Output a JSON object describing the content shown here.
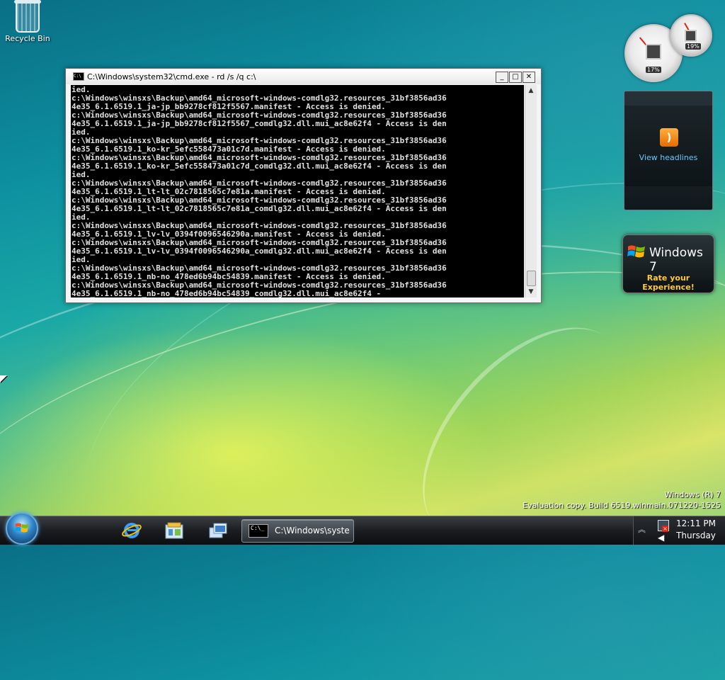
{
  "desktop": {
    "icons": [
      {
        "label": "Recycle Bin",
        "icon": "recycle-bin-icon"
      }
    ],
    "build_info": {
      "line1": "Windows (R) 7",
      "line2": "Evaluation copy. Build 6519.winmain.071220-1525"
    }
  },
  "cmd_window": {
    "title": "C:\\Windows\\system32\\cmd.exe - rd  /s /q c:\\",
    "controls": {
      "minimize": "_",
      "maximize": "□",
      "close": "✕"
    },
    "output": [
      "ied.",
      "c:\\Windows\\winsxs\\Backup\\amd64_microsoft-windows-comdlg32.resources_31bf3856ad36",
      "4e35_6.1.6519.1_ja-jp_bb9278cf812f5567.manifest - Access is denied.",
      "c:\\Windows\\winsxs\\Backup\\amd64_microsoft-windows-comdlg32.resources_31bf3856ad36",
      "4e35_6.1.6519.1_ja-jp_bb9278cf812f5567_comdlg32.dll.mui_ac8e62f4 - Access is den",
      "ied.",
      "c:\\Windows\\winsxs\\Backup\\amd64_microsoft-windows-comdlg32.resources_31bf3856ad36",
      "4e35_6.1.6519.1_ko-kr_5efc558473a01c7d.manifest - Access is denied.",
      "c:\\Windows\\winsxs\\Backup\\amd64_microsoft-windows-comdlg32.resources_31bf3856ad36",
      "4e35_6.1.6519.1_ko-kr_5efc558473a01c7d_comdlg32.dll.mui_ac8e62f4 - Access is den",
      "ied.",
      "c:\\Windows\\winsxs\\Backup\\amd64_microsoft-windows-comdlg32.resources_31bf3856ad36",
      "4e35_6.1.6519.1_lt-lt_02c7818565c7e81a.manifest - Access is denied.",
      "c:\\Windows\\winsxs\\Backup\\amd64_microsoft-windows-comdlg32.resources_31bf3856ad36",
      "4e35_6.1.6519.1_lt-lt_02c7818565c7e81a_comdlg32.dll.mui_ac8e62f4 - Access is den",
      "ied.",
      "c:\\Windows\\winsxs\\Backup\\amd64_microsoft-windows-comdlg32.resources_31bf3856ad36",
      "4e35_6.1.6519.1_lv-lv_0394f0096546290a.manifest - Access is denied.",
      "c:\\Windows\\winsxs\\Backup\\amd64_microsoft-windows-comdlg32.resources_31bf3856ad36",
      "4e35_6.1.6519.1_lv-lv_0394f0096546290a_comdlg32.dll.mui_ac8e62f4 - Access is den",
      "ied.",
      "c:\\Windows\\winsxs\\Backup\\amd64_microsoft-windows-comdlg32.resources_31bf3856ad36",
      "4e35_6.1.6519.1_nb-no_478ed6b94bc54839.manifest - Access is denied.",
      "c:\\Windows\\winsxs\\Backup\\amd64_microsoft-windows-comdlg32.resources_31bf3856ad36",
      "4e35_6.1.6519.1_nb-no_478ed6b94bc54839_comdlg32.dll.mui_ac8e62f4 -"
    ]
  },
  "gadgets": {
    "cpu_meter": {
      "cpu_percent": "17%",
      "memory_percent": "19%"
    },
    "feed_headlines": {
      "link": "View headlines"
    },
    "windows7": {
      "title": "Windows 7",
      "subtitle": "Rate your Experience!"
    }
  },
  "taskbar": {
    "quick_launch": [
      "internet-explorer-icon",
      "windows-explorer-icon",
      "switch-windows-icon"
    ],
    "tasks": [
      {
        "label": "C:\\Windows\\syster",
        "icon_text": "C:\\_"
      }
    ],
    "tray": {
      "time": "12:11 PM",
      "day": "Thursday"
    }
  },
  "colors": {
    "accent": "#69c7ff",
    "rate_text": "#ffc93a",
    "close_red": "#d21111"
  }
}
